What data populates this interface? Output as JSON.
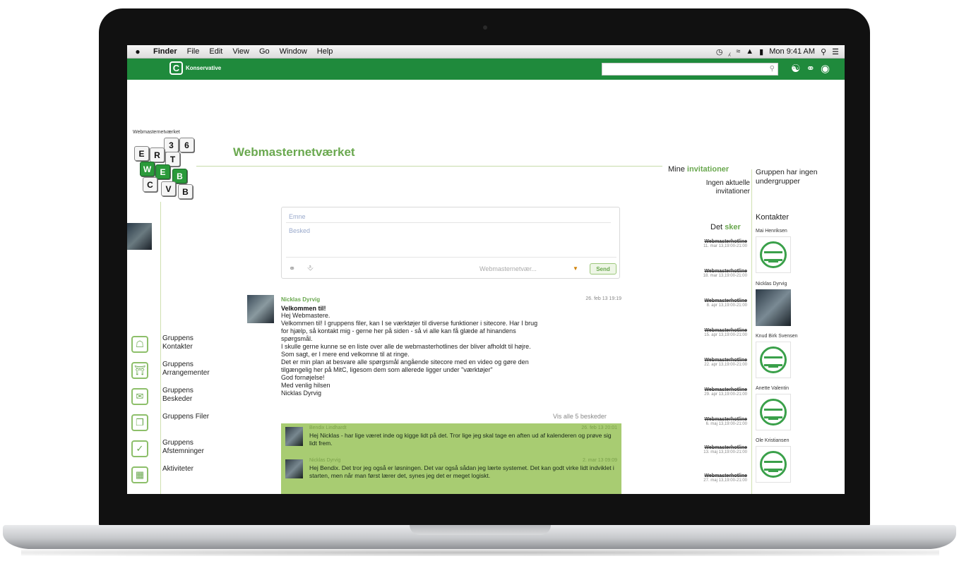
{
  "menubar": {
    "apple": "",
    "items": [
      "Finder",
      "File",
      "Edit",
      "View",
      "Go",
      "Window",
      "Help"
    ],
    "clock": "Mon 9:41 AM"
  },
  "header": {
    "logo_letter": "C",
    "logo_text": "Konservative",
    "search_placeholder": "",
    "brand_color": "#1f8a3c"
  },
  "left": {
    "group_label": "Webmasternetværket",
    "keys": [
      "3",
      "6",
      "E",
      "R",
      "T",
      "W",
      "E",
      "B",
      "C",
      "V",
      "B"
    ],
    "nav": [
      {
        "label": "Gruppens Kontakter",
        "icon": "contacts-icon",
        "glyph": "☖"
      },
      {
        "label": "Gruppens Arrangementer",
        "icon": "events-icon",
        "glyph": "⛩"
      },
      {
        "label": "Gruppens Beskeder",
        "icon": "messages-icon",
        "glyph": "✉"
      },
      {
        "label": "Gruppens Filer",
        "icon": "files-icon",
        "glyph": "❐"
      },
      {
        "label": "Gruppens Afstemninger",
        "icon": "polls-icon",
        "glyph": "✓"
      },
      {
        "label": "Aktiviteter",
        "icon": "calendar-icon",
        "glyph": "▦"
      }
    ]
  },
  "main": {
    "title": "Webmasternetværket",
    "composer": {
      "subject_placeholder": "Emne",
      "message_placeholder": "Besked",
      "target": "Webmasternetvær...",
      "send_label": "Send"
    },
    "post": {
      "author": "Nicklas Dyrvig",
      "date": "26. feb 13 19:19",
      "subject": "Velkommen til!",
      "lines": [
        "Hej Webmastere.",
        "Velkommen til! I gruppens filer, kan I se værktøjer til diverse funktioner i sitecore. Har I brug",
        "for hjælp, så kontakt mig - gerne her på siden - så vi alle kan få glæde af hinandens",
        "spørgsmål.",
        "I skulle gerne kunne se en liste over alle de webmasterhotlines der bliver afholdt til højre.",
        "Som sagt, er I mere end velkomne til at ringe.",
        "Det er min plan at besvare alle spørgsmål angående sitecore med en video og gøre den",
        "tilgængelig her på MitC, ligesom dem som allerede ligger under \"værktøjer\"",
        "God fornøjelse!",
        "Med venlig hilsen",
        "Nicklas Dyrvig"
      ]
    },
    "show_all": "Vis alle 5 beskeder",
    "replies": [
      {
        "author": "Bendix Lindhardt",
        "date": "26. feb 13 20:01",
        "text": "Hej Nicklas - har lige været inde og kigge lidt på det. Tror lige jeg skal tage en aften ud af kalenderen og prøve sig lidt frem."
      },
      {
        "author": "Nicklas Dyrvig",
        "date": "2. mar 13 09:09",
        "text": "Hej Bendix. Det tror jeg også er løsningen. Det var også sådan jeg lærte systemet. Det kan godt virke lidt indviklet i starten, men når man først lærer det, synes jeg det er meget logiskt."
      }
    ]
  },
  "invitations": {
    "title_prefix": "Mine",
    "title_accent": "invitationer",
    "empty_text": "Ingen aktuelle invitationer"
  },
  "events": {
    "title_prefix": "Det",
    "title_accent": "sker",
    "items": [
      {
        "name": "Webmasterhotline",
        "date": "11. mar 13,19:00-21:00"
      },
      {
        "name": "Webmasterhotline",
        "date": "18. mar 13,19:00-21:00"
      },
      {
        "name": "Webmasterhotline",
        "date": "8. apr 13,19:00-21:00"
      },
      {
        "name": "Webmasterhotline",
        "date": "15. apr 13,19:00-21:00"
      },
      {
        "name": "Webmasterhotline",
        "date": "22. apr 13,19:00-21:00"
      },
      {
        "name": "Webmasterhotline",
        "date": "29. apr 13,19:00-21:00"
      },
      {
        "name": "Webmasterhotline",
        "date": "6. maj 13,19:00-21:00"
      },
      {
        "name": "Webmasterhotline",
        "date": "13. maj 13,19:00-21:00"
      },
      {
        "name": "Webmasterhotline",
        "date": "27. maj 13,19:00-21:00"
      }
    ]
  },
  "sidebar": {
    "subgroups_text": "Gruppen har ingen undergrupper",
    "contacts_title": "Kontakter",
    "contacts": [
      {
        "name": "Mai Henriksen",
        "photo": false
      },
      {
        "name": "Nicklas Dyrvig",
        "photo": true
      },
      {
        "name": "Knud Birk Svensen",
        "photo": false
      },
      {
        "name": "Anette Valentin",
        "photo": false
      },
      {
        "name": "Ole Kristiansen",
        "photo": false
      }
    ]
  }
}
